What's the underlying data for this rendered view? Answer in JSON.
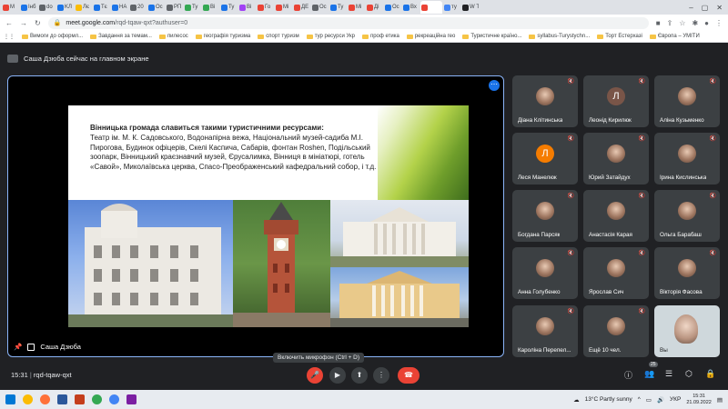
{
  "browser": {
    "tabs": [
      {
        "label": "M",
        "color": "#ea4335"
      },
      {
        "label": "Інб",
        "color": "#1a73e8"
      },
      {
        "label": "do",
        "color": "#5f6368"
      },
      {
        "label": "KЛ",
        "color": "#1a73e8"
      },
      {
        "label": "Лє",
        "color": "#fbbc04"
      },
      {
        "label": "Тє",
        "color": "#1a73e8"
      },
      {
        "label": "НА",
        "color": "#1a73e8"
      },
      {
        "label": "20",
        "color": "#5f6368"
      },
      {
        "label": "Ос",
        "color": "#1a73e8"
      },
      {
        "label": "РП",
        "color": "#5f6368"
      },
      {
        "label": "Ту",
        "color": "#34a853"
      },
      {
        "label": "Ві",
        "color": "#34a853"
      },
      {
        "label": "Ту",
        "color": "#1a73e8"
      },
      {
        "label": "Ві",
        "color": "#a142f4"
      },
      {
        "label": "Го",
        "color": "#ea4335"
      },
      {
        "label": "Мі",
        "color": "#ea4335"
      },
      {
        "label": "ДЕ",
        "color": "#ea4335"
      },
      {
        "label": "Ос",
        "color": "#5f6368"
      },
      {
        "label": "Ту",
        "color": "#1a73e8"
      },
      {
        "label": "Мі",
        "color": "#ea4335"
      },
      {
        "label": "Ді",
        "color": "#ea4335"
      },
      {
        "label": "Ос",
        "color": "#1a73e8"
      },
      {
        "label": "Вх",
        "color": "#1a73e8"
      },
      {
        "label": "",
        "color": "#ea4335",
        "active": true
      },
      {
        "label": "ту",
        "color": "#4285f4"
      },
      {
        "label": "W Ту",
        "color": "#202124"
      }
    ],
    "url_host": "meet.google.com",
    "url_path": "/rqd-tqaw-qxt?authuser=0",
    "bookmarks": [
      {
        "label": "Вимоги до оформл..."
      },
      {
        "label": "Завдання за темам..."
      },
      {
        "label": "пилесос"
      },
      {
        "label": "географія туризма"
      },
      {
        "label": "спорт туризм"
      },
      {
        "label": "тур ресурси Укр"
      },
      {
        "label": "проф етика"
      },
      {
        "label": "рекреаційна гео"
      },
      {
        "label": "Туристичне країнo..."
      },
      {
        "label": "syllabus-Turystychn..."
      },
      {
        "label": "Торт Естерхазі"
      },
      {
        "label": "Європа – УМІТИ"
      }
    ]
  },
  "meet": {
    "presenting_text": "Саша Дзюба сейчас на главном экране",
    "presenter_name": "Саша Дзюба",
    "slide": {
      "heading": "Вінницька громада славиться такими туристичними ресурсами:",
      "body": "Театр ім. М. К. Садовського, Водонапірна вежа, Національний музей-садиба М.І. Пирогова, Будинок офіцерів, Скелі Каспича, Сабарів, фонтан Roshen, Подільський зоопарк, Вінницький краєзнавчий музей, Єрусалимка, Вінниця в мініатюрі, готель «Савой», Миколаївська церква, Спасо-Преображенський кафедральний собор, і т.д."
    },
    "participants": [
      {
        "name": "Діана Клітинська",
        "initial": "",
        "color": "#a07862"
      },
      {
        "name": "Леонід Кирилюк",
        "initial": "Л",
        "color": "#795548"
      },
      {
        "name": "Аліна Кузьменко",
        "initial": "",
        "color": "#9e9e9e"
      },
      {
        "name": "Леся Манелюк",
        "initial": "Л",
        "color": "#f57c00"
      },
      {
        "name": "Юрий Затайдух",
        "initial": "",
        "color": "#6d4c41"
      },
      {
        "name": "Ірина Кислинська",
        "initial": "",
        "color": "#8d6e63"
      },
      {
        "name": "Богдана Парсяк",
        "initial": "",
        "color": "#c62828"
      },
      {
        "name": "Анастасія Карая",
        "initial": "",
        "color": "#6d4c41"
      },
      {
        "name": "Ольга Барабаш",
        "initial": "",
        "color": "#7b5e57"
      },
      {
        "name": "Анна Голубенко",
        "initial": "",
        "color": "#5d4037"
      },
      {
        "name": "Ярослав Сич",
        "initial": "",
        "color": "#bdbdbd"
      },
      {
        "name": "Вікторія Фасова",
        "initial": "",
        "color": "#689f38"
      },
      {
        "name": "Кароліна Перепел...",
        "initial": "",
        "color": "#a1887f"
      },
      {
        "name": "Ещё 10 чел.",
        "initial": "",
        "color": "#616161"
      },
      {
        "name": "Вы",
        "initial": "",
        "color": "#cfd8dc"
      }
    ],
    "tooltip": "Включить микрофон (Ctrl + D)",
    "time": "15:31",
    "meeting_code": "rqd-tqaw-qxt",
    "participant_count": "25"
  },
  "taskbar": {
    "weather": "13°C  Partly sunny",
    "lang": "УКР",
    "time": "15:31",
    "date": "21.09.2022"
  }
}
